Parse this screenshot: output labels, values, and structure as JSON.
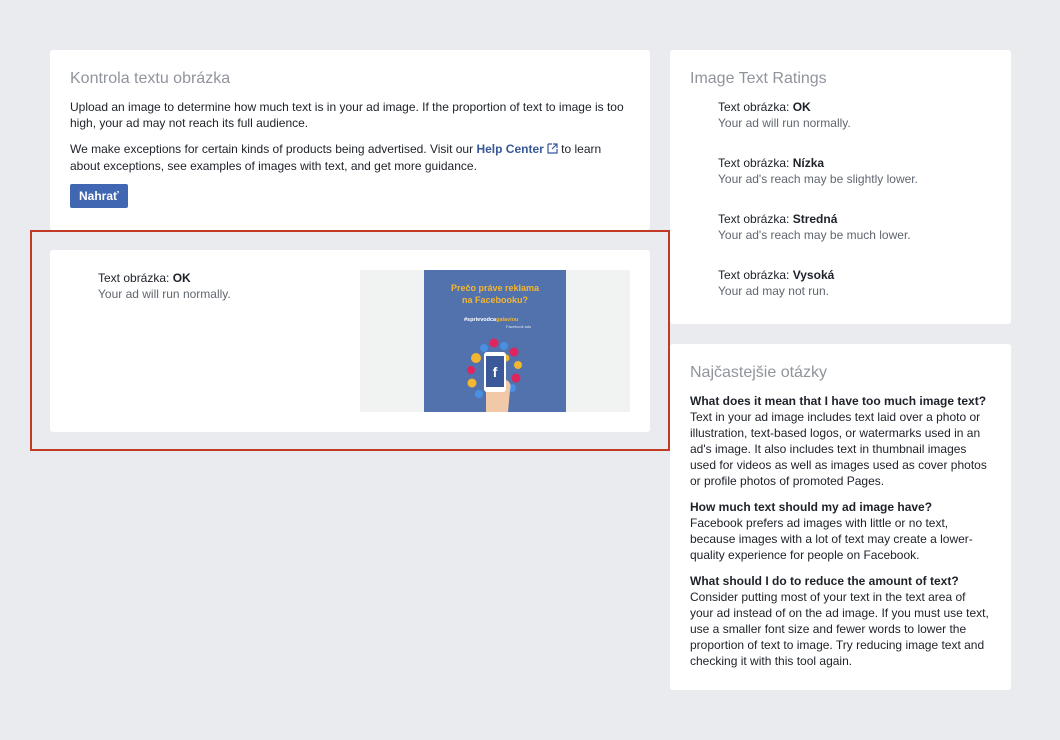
{
  "upload_card": {
    "title": "Kontrola textu obrázka",
    "intro": "Upload an image to determine how much text is in your ad image. If the proportion of text to image is too high, your ad may not reach its full audience.",
    "exceptions_before": "We make exceptions for certain kinds of products being advertised. Visit our",
    "help_center_label": "Help Center",
    "exceptions_after": "to learn about exceptions, see examples of images with text, and get more guidance.",
    "upload_button": "Nahrať"
  },
  "result_card": {
    "label": "Text obrázka: ",
    "rating": "OK",
    "message": "Your ad will run normally.",
    "ad_image": {
      "headline_line1": "Prečo práve reklama",
      "headline_line2": "na Facebooku?",
      "hashtag_prefix": "#sprievodca",
      "hashtag_suffix": "galaviou",
      "subline": "Facebook ads",
      "accent_color": "#f3b630",
      "background_color": "#5272ae"
    }
  },
  "ratings_card": {
    "title": "Image Text Ratings",
    "items": [
      {
        "label": "Text obrázka: ",
        "level": "OK",
        "description": "Your ad will run normally."
      },
      {
        "label": "Text obrázka: ",
        "level": "Nízka",
        "description": "Your ad's reach may be slightly lower."
      },
      {
        "label": "Text obrázka: ",
        "level": "Stredná",
        "description": "Your ad's reach may be much lower."
      },
      {
        "label": "Text obrázka: ",
        "level": "Vysoká",
        "description": "Your ad may not run."
      }
    ]
  },
  "faq_card": {
    "title": "Najčastejšie otázky",
    "items": [
      {
        "question": "What does it mean that I have too much image text?",
        "answer": "Text in your ad image includes text laid over a photo or illustration, text-based logos, or watermarks used in an ad's image. It also includes text in thumbnail images used for videos as well as images used as cover photos or profile photos of promoted Pages."
      },
      {
        "question": "How much text should my ad image have?",
        "answer": "Facebook prefers ad images with little or no text, because images with a lot of text may create a lower-quality experience for people on Facebook."
      },
      {
        "question": "What should I do to reduce the amount of text?",
        "answer": "Consider putting most of your text in the text area of your ad instead of on the ad image. If you must use text, use a smaller font size and fewer words to lower the proportion of text to image. Try reducing image text and checking it with this tool again."
      }
    ]
  },
  "colors": {
    "page_background": "#e9ebee",
    "link": "#365899",
    "button": "#4267b2",
    "highlight": "#c23a23"
  }
}
